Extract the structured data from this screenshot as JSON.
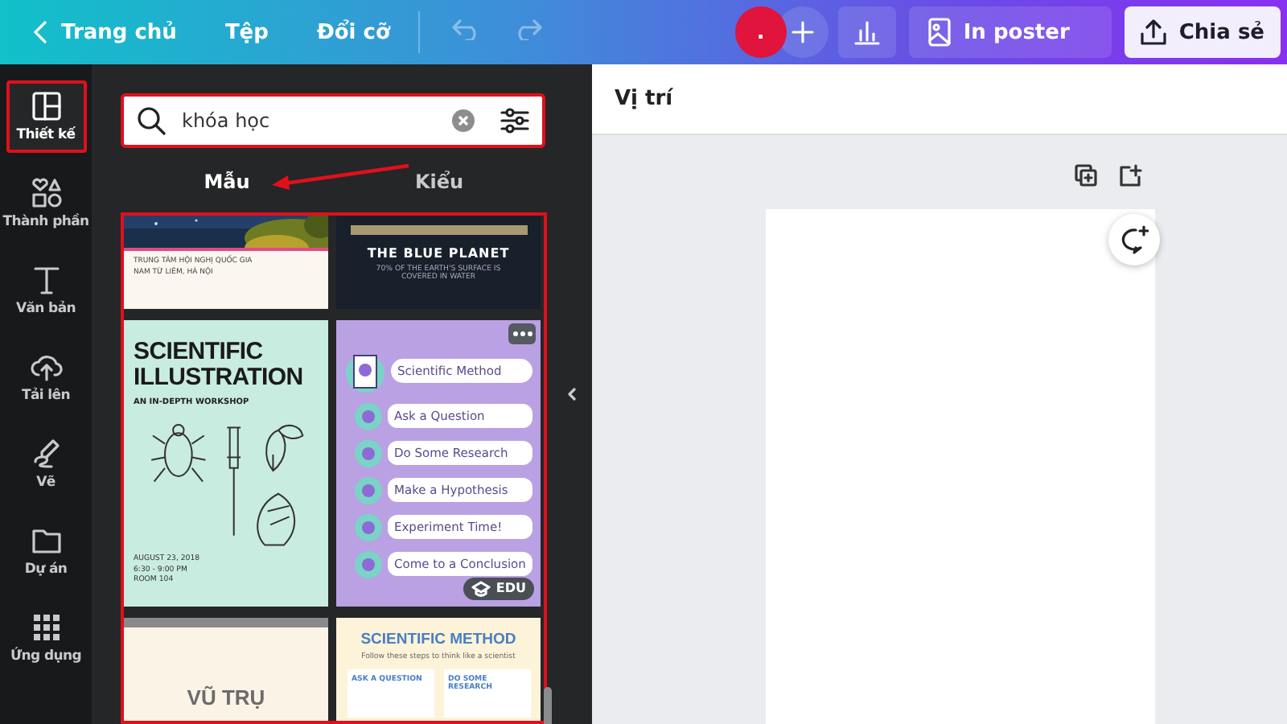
{
  "topbar": {
    "back_label": "Trang chủ",
    "menus": [
      "Tệp",
      "Đổi cỡ"
    ],
    "avatar_initial": ".",
    "print_button": "In poster",
    "share_button": "Chia sẻ"
  },
  "sidebar": {
    "items": [
      {
        "kind": "layout",
        "label": "Thiết kế",
        "selected": true,
        "highlighted": true
      },
      {
        "kind": "shapes",
        "label": "Thành phần",
        "selected": false,
        "highlighted": false
      },
      {
        "kind": "text",
        "label": "Văn bản",
        "selected": false,
        "highlighted": false
      },
      {
        "kind": "upload",
        "label": "Tải lên",
        "selected": false,
        "highlighted": false
      },
      {
        "kind": "draw",
        "label": "Vẽ",
        "selected": false,
        "highlighted": false
      },
      {
        "kind": "folder",
        "label": "Dự án",
        "selected": false,
        "highlighted": false
      },
      {
        "kind": "apps",
        "label": "Ứng dụng",
        "selected": false,
        "highlighted": false
      }
    ]
  },
  "search": {
    "value": "khóa học",
    "highlighted": true
  },
  "tabs": [
    {
      "label": "Mẫu",
      "selected": true
    },
    {
      "label": "Kiểu",
      "selected": false
    }
  ],
  "templates": {
    "highlighted": true,
    "items": [
      {
        "kind": "venue",
        "lines": [
          "TRUNG TÂM HỘI NGHỊ QUỐC GIA",
          "NAM TỪ LIÊM, HÀ NỘI"
        ]
      },
      {
        "kind": "dark",
        "title": "THE BLUE PLANET",
        "subtitle": "70% OF THE EARTH'S SURFACE IS COVERED IN WATER"
      },
      {
        "kind": "workshop",
        "title": "SCIENTIFIC ILLUSTRATION",
        "subtitle": "AN IN-DEPTH WORKSHOP",
        "details": [
          "AUGUST 23, 2018",
          "6:30 - 9:00 PM",
          "ROOM 104"
        ]
      },
      {
        "kind": "steps",
        "title": "Scientific Method",
        "steps": [
          "Ask a Question",
          "Do Some Research",
          "Make a Hypothesis",
          "Experiment Time!",
          "Come to a Conclusion"
        ],
        "badge": "EDU"
      },
      {
        "kind": "cream",
        "title": "VŨ TRỤ"
      },
      {
        "kind": "method",
        "title": "SCIENTIFIC METHOD",
        "subtitle": "Follow these steps to think like a scientist",
        "steps": [
          "ASK A QUESTION",
          "DO SOME RESEARCH"
        ]
      }
    ]
  },
  "canvas": {
    "header": "Vị trí"
  }
}
